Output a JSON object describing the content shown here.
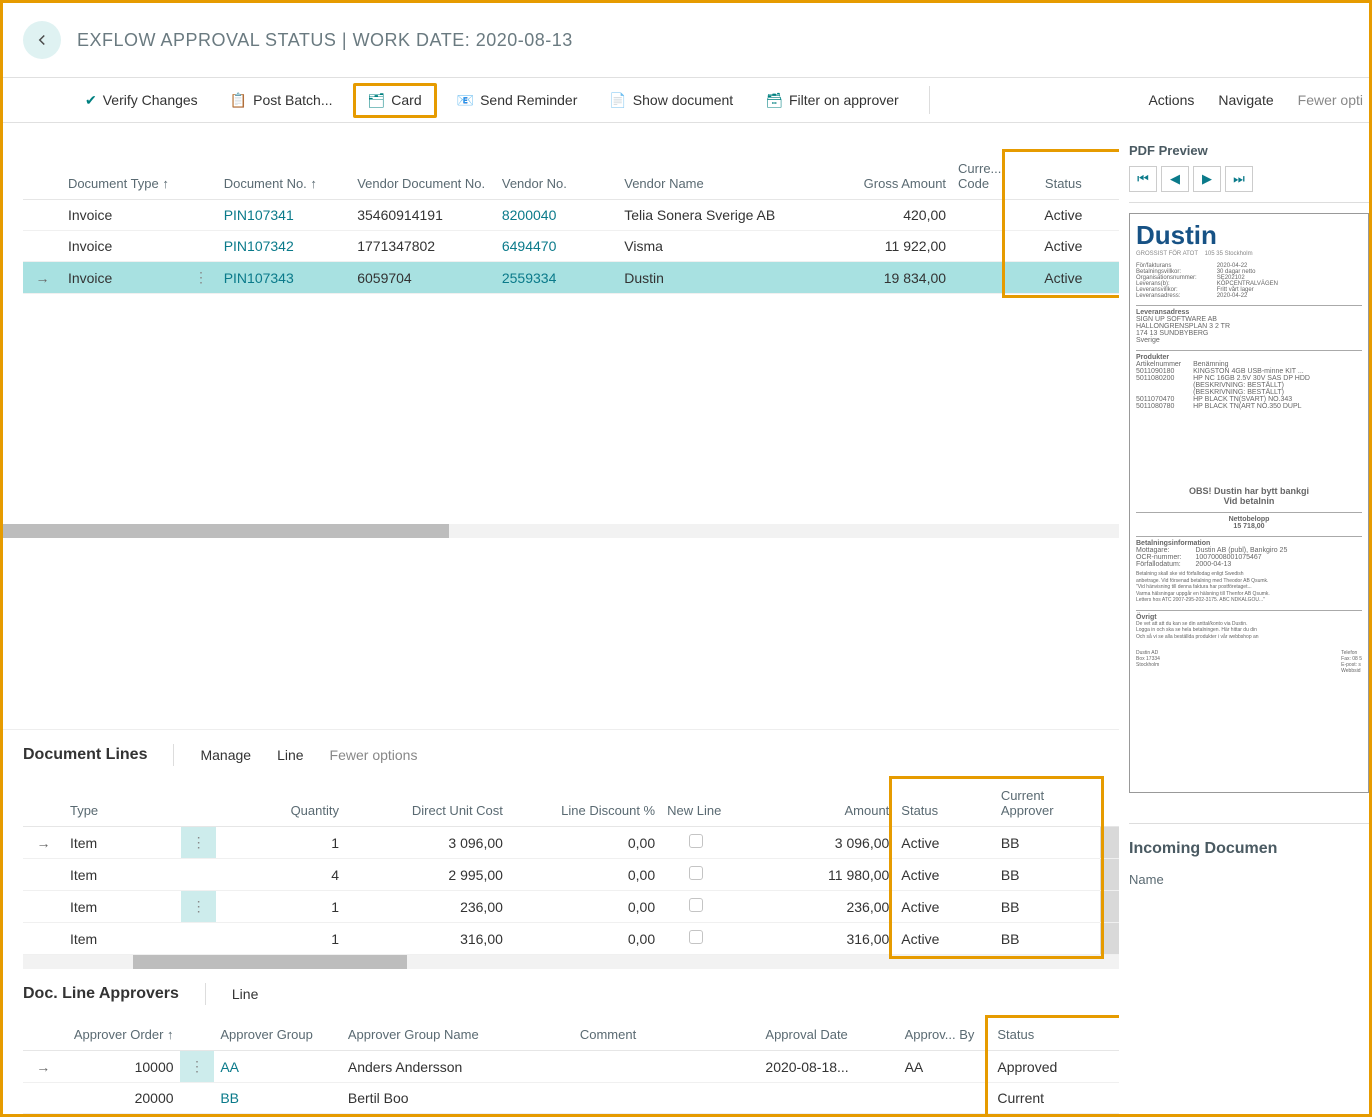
{
  "header": {
    "title": "EXFLOW APPROVAL STATUS | WORK DATE: 2020-08-13"
  },
  "toolbar": {
    "verify": "Verify Changes",
    "post": "Post Batch...",
    "card": "Card",
    "reminder": "Send Reminder",
    "show_doc": "Show document",
    "filter": "Filter on approver",
    "actions": "Actions",
    "navigate": "Navigate",
    "fewer": "Fewer opti"
  },
  "top_table": {
    "cols": {
      "doc_type": "Document Type ↑",
      "doc_no": "Document No. ↑",
      "vendor_doc_no": "Vendor Document No.",
      "vendor_no": "Vendor No.",
      "vendor_name": "Vendor Name",
      "gross": "Gross Amount",
      "curr": "Curre... Code",
      "status": "Status"
    },
    "rows": [
      {
        "type": "Invoice",
        "docno": "PIN107341",
        "vdoc": "35460914191",
        "vno": "8200040",
        "vname": "Telia Sonera Sverige AB",
        "gross": "420,00",
        "status": "Active",
        "selected": false
      },
      {
        "type": "Invoice",
        "docno": "PIN107342",
        "vdoc": "1771347802",
        "vno": "6494470",
        "vname": "Visma",
        "gross": "11 922,00",
        "status": "Active",
        "selected": false
      },
      {
        "type": "Invoice",
        "docno": "PIN107343",
        "vdoc": "6059704",
        "vno": "2559334",
        "vname": "Dustin",
        "gross": "19 834,00",
        "status": "Active",
        "selected": true
      }
    ]
  },
  "doc_lines": {
    "title": "Document Lines",
    "tabs": {
      "manage": "Manage",
      "line": "Line",
      "fewer": "Fewer options"
    },
    "cols": {
      "type": "Type",
      "qty": "Quantity",
      "unit": "Direct Unit Cost",
      "disc": "Line Discount %",
      "newline": "New Line",
      "amount": "Amount",
      "status": "Status",
      "approver": "Current Approver"
    },
    "rows": [
      {
        "type": "Item",
        "qty": "1",
        "unit": "3 096,00",
        "disc": "0,00",
        "amount": "3 096,00",
        "status": "Active",
        "approver": "BB",
        "selected": true
      },
      {
        "type": "Item",
        "qty": "4",
        "unit": "2 995,00",
        "disc": "0,00",
        "amount": "11 980,00",
        "status": "Active",
        "approver": "BB",
        "selected": false
      },
      {
        "type": "Item",
        "qty": "1",
        "unit": "236,00",
        "disc": "0,00",
        "amount": "236,00",
        "status": "Active",
        "approver": "BB",
        "selected": false
      },
      {
        "type": "Item",
        "qty": "1",
        "unit": "316,00",
        "disc": "0,00",
        "amount": "316,00",
        "status": "Active",
        "approver": "BB",
        "selected": false
      }
    ]
  },
  "approvers": {
    "title": "Doc. Line Approvers",
    "tabs": {
      "line": "Line"
    },
    "cols": {
      "order": "Approver Order ↑",
      "group": "Approver Group",
      "gname": "Approver Group Name",
      "comment": "Comment",
      "adate": "Approval Date",
      "aby": "Approv... By",
      "status": "Status"
    },
    "rows": [
      {
        "order": "10000",
        "group": "AA",
        "gname": "Anders Andersson",
        "comment": "",
        "adate": "2020-08-18...",
        "aby": "AA",
        "status": "Approved",
        "selected": true
      },
      {
        "order": "20000",
        "group": "BB",
        "gname": "Bertil Boo",
        "comment": "",
        "adate": "",
        "aby": "",
        "status": "Current",
        "selected": false
      }
    ]
  },
  "pdf": {
    "title": "PDF Preview",
    "notice": "OBS! Dustin har bytt bankgi",
    "notice2": "Vid betalnin",
    "logo": "Dustin"
  },
  "incoming": {
    "title": "Incoming Documen",
    "col": "Name"
  }
}
